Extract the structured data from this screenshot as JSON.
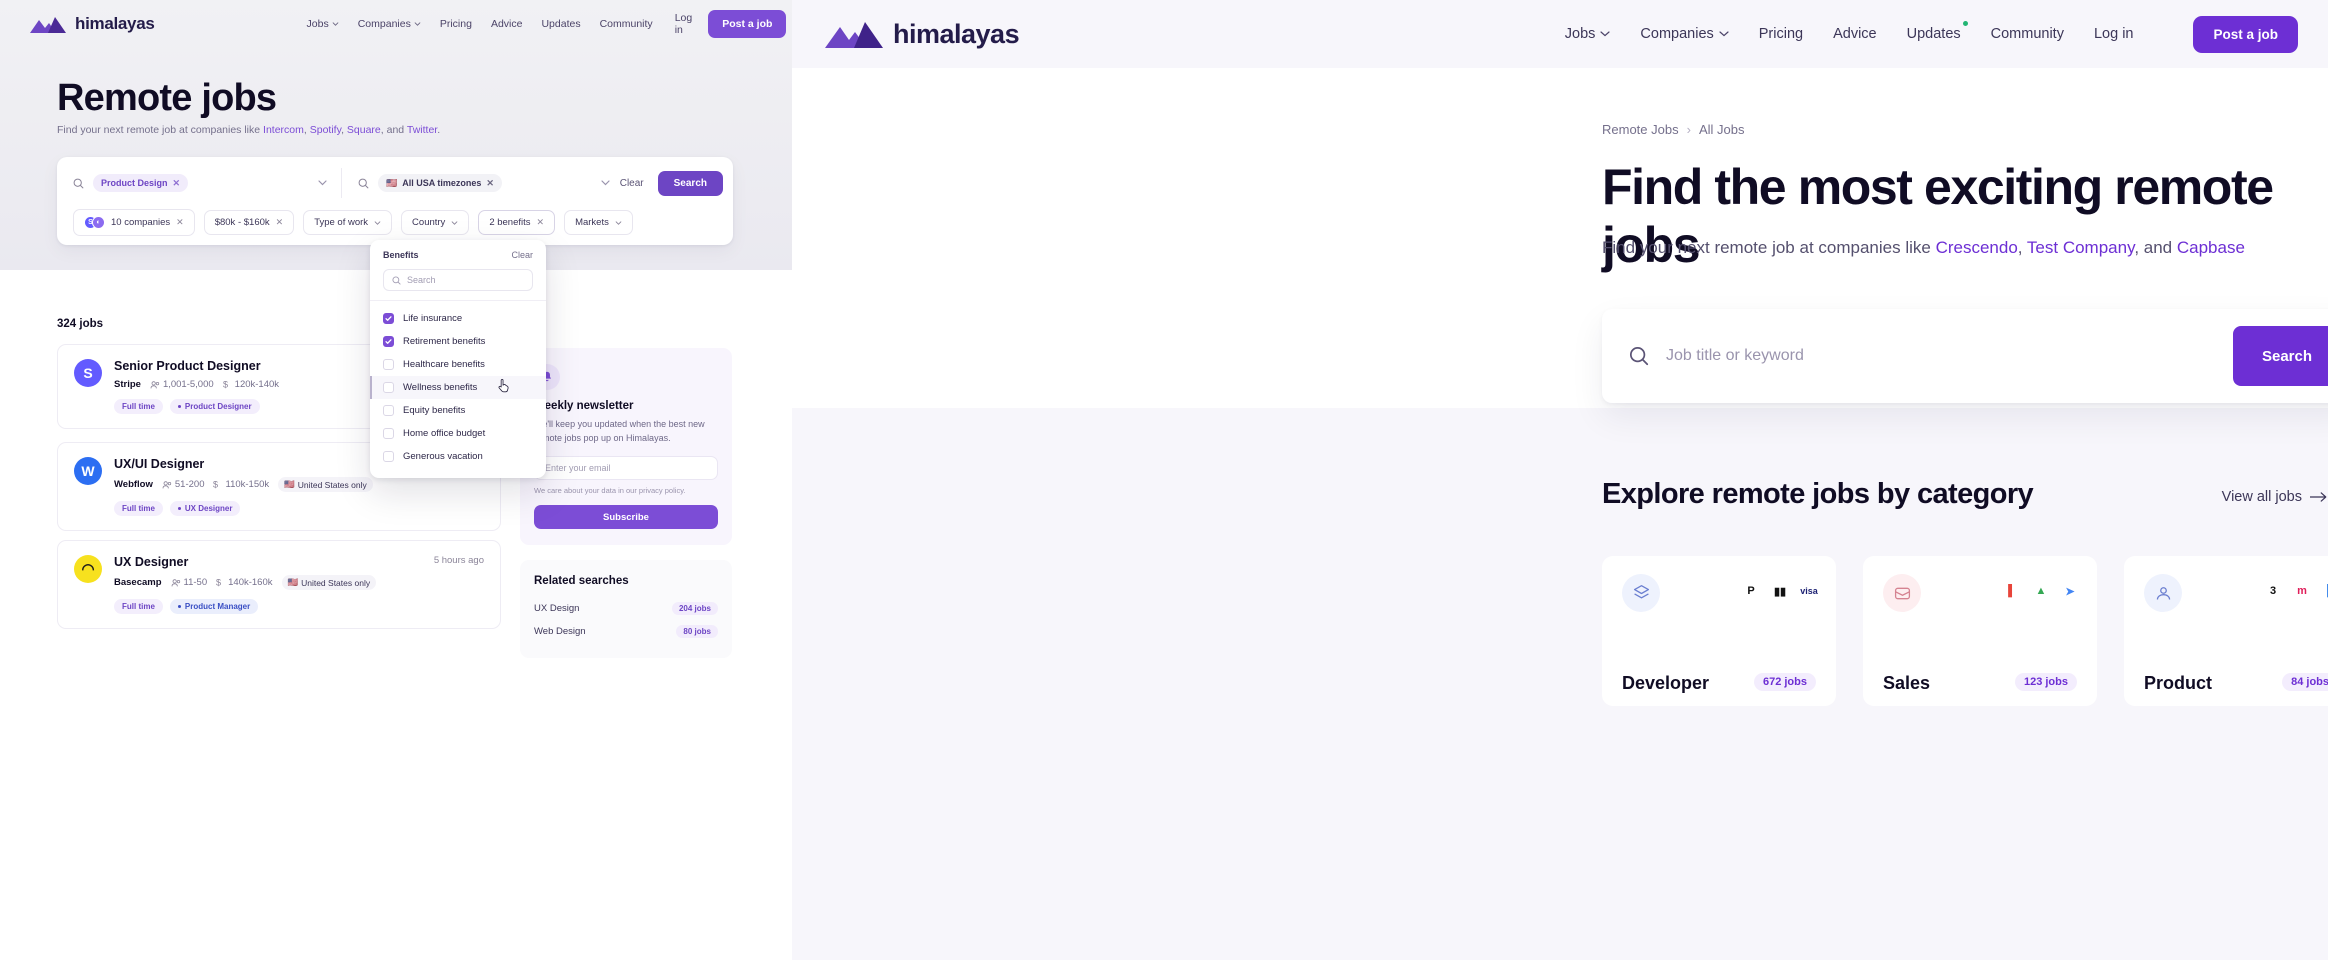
{
  "left": {
    "nav": {
      "logo_text": "himalayas",
      "links": [
        {
          "label": "Jobs",
          "caret": true
        },
        {
          "label": "Companies",
          "caret": true
        },
        {
          "label": "Pricing",
          "caret": false
        },
        {
          "label": "Advice",
          "caret": false
        },
        {
          "label": "Updates",
          "caret": false
        },
        {
          "label": "Community",
          "caret": false
        }
      ],
      "login": "Log in",
      "post_job": "Post a job"
    },
    "title": "Remote jobs",
    "subtitle_prefix": "Find your next remote job at companies like ",
    "subtitle_companies": [
      "Intercom",
      "Spotify",
      "Square",
      "Twitter"
    ],
    "search": {
      "keyword_chip": "Product Design",
      "timezone_chip": "All USA timezones",
      "timezone_flag": "🇺🇸",
      "clear_label": "Clear",
      "search_label": "Search"
    },
    "filters": [
      {
        "label": "10 companies",
        "type": "avatars",
        "removable": true
      },
      {
        "label": "$80k - $160k",
        "type": "plain",
        "removable": true
      },
      {
        "label": "Type of work",
        "type": "dropdown",
        "removable": false
      },
      {
        "label": "Country",
        "type": "dropdown",
        "removable": false
      },
      {
        "label": "2 benefits",
        "type": "plain",
        "removable": true,
        "active": true
      },
      {
        "label": "Markets",
        "type": "dropdown",
        "removable": false
      }
    ],
    "benefits_dropdown": {
      "title": "Benefits",
      "clear": "Clear",
      "search_placeholder": "Search",
      "items": [
        {
          "label": "Life insurance",
          "checked": true,
          "hover": false
        },
        {
          "label": "Retirement benefits",
          "checked": true,
          "hover": false
        },
        {
          "label": "Healthcare benefits",
          "checked": false,
          "hover": false
        },
        {
          "label": "Wellness benefits",
          "checked": false,
          "hover": true
        },
        {
          "label": "Equity benefits",
          "checked": false,
          "hover": false
        },
        {
          "label": "Home office budget",
          "checked": false,
          "hover": false
        },
        {
          "label": "Generous vacation",
          "checked": false,
          "hover": false
        }
      ]
    },
    "jobs_count": "324 jobs",
    "jobs": [
      {
        "title": "Senior Product Designer",
        "company": "Stripe",
        "logo_letter": "S",
        "logo_bg": "#635bff",
        "size": "1,001-5,000",
        "salary": "120k-140k",
        "location": "",
        "tags": [
          {
            "label": "Full time",
            "style": "lilac",
            "dot": false
          },
          {
            "label": "Product Designer",
            "style": "lilac",
            "dot": true
          }
        ],
        "posted": ""
      },
      {
        "title": "UX/UI Designer",
        "company": "Webflow",
        "logo_letter": "W",
        "logo_bg": "#2c6ef2",
        "size": "51-200",
        "salary": "110k-150k",
        "location": "United States only",
        "tags": [
          {
            "label": "Full time",
            "style": "lilac",
            "dot": false
          },
          {
            "label": "UX Designer",
            "style": "lilac",
            "dot": true
          }
        ],
        "posted": ""
      },
      {
        "title": "UX Designer",
        "company": "Basecamp",
        "logo_letter": "◠",
        "logo_bg": "#f7e11e",
        "size": "11-50",
        "salary": "140k-160k",
        "location": "United States only",
        "tags": [
          {
            "label": "Full time",
            "style": "lilac",
            "dot": false
          },
          {
            "label": "Product Manager",
            "style": "blue",
            "dot": true
          }
        ],
        "posted": "5 hours ago"
      }
    ],
    "newsletter": {
      "title": "Weekly newsletter",
      "body": "We'll keep you updated when the best new remote jobs pop up on Himalayas.",
      "email_placeholder": "Enter your email",
      "note": "We care about your data in our privacy policy.",
      "button": "Subscribe"
    },
    "related": {
      "title": "Related searches",
      "rows": [
        {
          "label": "UX Design",
          "count": "204 jobs"
        },
        {
          "label": "Web Design",
          "count": "80 jobs"
        }
      ]
    }
  },
  "right": {
    "nav": {
      "logo_text": "himalayas",
      "links": [
        {
          "label": "Jobs",
          "caret": true,
          "dot": false
        },
        {
          "label": "Companies",
          "caret": true,
          "dot": false
        },
        {
          "label": "Pricing",
          "caret": false,
          "dot": false
        },
        {
          "label": "Advice",
          "caret": false,
          "dot": false
        },
        {
          "label": "Updates",
          "caret": false,
          "dot": true
        },
        {
          "label": "Community",
          "caret": false,
          "dot": false
        },
        {
          "label": "Log in",
          "caret": false,
          "dot": false
        }
      ],
      "post_job": "Post a job"
    },
    "breadcrumb": {
      "items": [
        "Remote Jobs",
        "All Jobs"
      ],
      "separator": "›"
    },
    "heading": "Find the most exciting remote jobs",
    "lede_prefix": "Find your next remote job at companies like ",
    "lede_companies": [
      "Crescendo",
      "Test Company",
      "Capbase"
    ],
    "lede_joiner_1": ", ",
    "lede_joiner_2": ", and ",
    "search": {
      "placeholder": "Job title or keyword",
      "button": "Search"
    },
    "section_title": "Explore remote jobs by category",
    "view_all": "View all jobs",
    "categories": [
      {
        "name": "Developer",
        "jobs": "672 jobs",
        "icon_bg": "#eef2fd",
        "icon_color": "#6b7fd0",
        "logos": [
          {
            "text": "P",
            "bg": "#ffffff",
            "color": "#111111"
          },
          {
            "text": "▮▮",
            "bg": "#ffffff",
            "color": "#111111"
          },
          {
            "text": "visa",
            "bg": "#ffffff",
            "color": "#1a1f71"
          }
        ]
      },
      {
        "name": "Sales",
        "jobs": "123 jobs",
        "icon_bg": "#fdeef0",
        "icon_color": "#d58391",
        "logos": [
          {
            "text": "▌",
            "bg": "#ffffff",
            "color": "#e8443a"
          },
          {
            "text": "▲",
            "bg": "#ffffff",
            "color": "#34a853"
          },
          {
            "text": "➤",
            "bg": "#ffffff",
            "color": "#4285f4"
          }
        ]
      },
      {
        "name": "Product",
        "jobs": "84 jobs",
        "icon_bg": "#eef2fd",
        "icon_color": "#6b7fd0",
        "logos": [
          {
            "text": "3",
            "bg": "#ffffff",
            "color": "#111111"
          },
          {
            "text": "m",
            "bg": "#ffffff",
            "color": "#e01e5a"
          },
          {
            "text": "▌",
            "bg": "#ffffff",
            "color": "#2b7de9"
          }
        ]
      }
    ]
  }
}
